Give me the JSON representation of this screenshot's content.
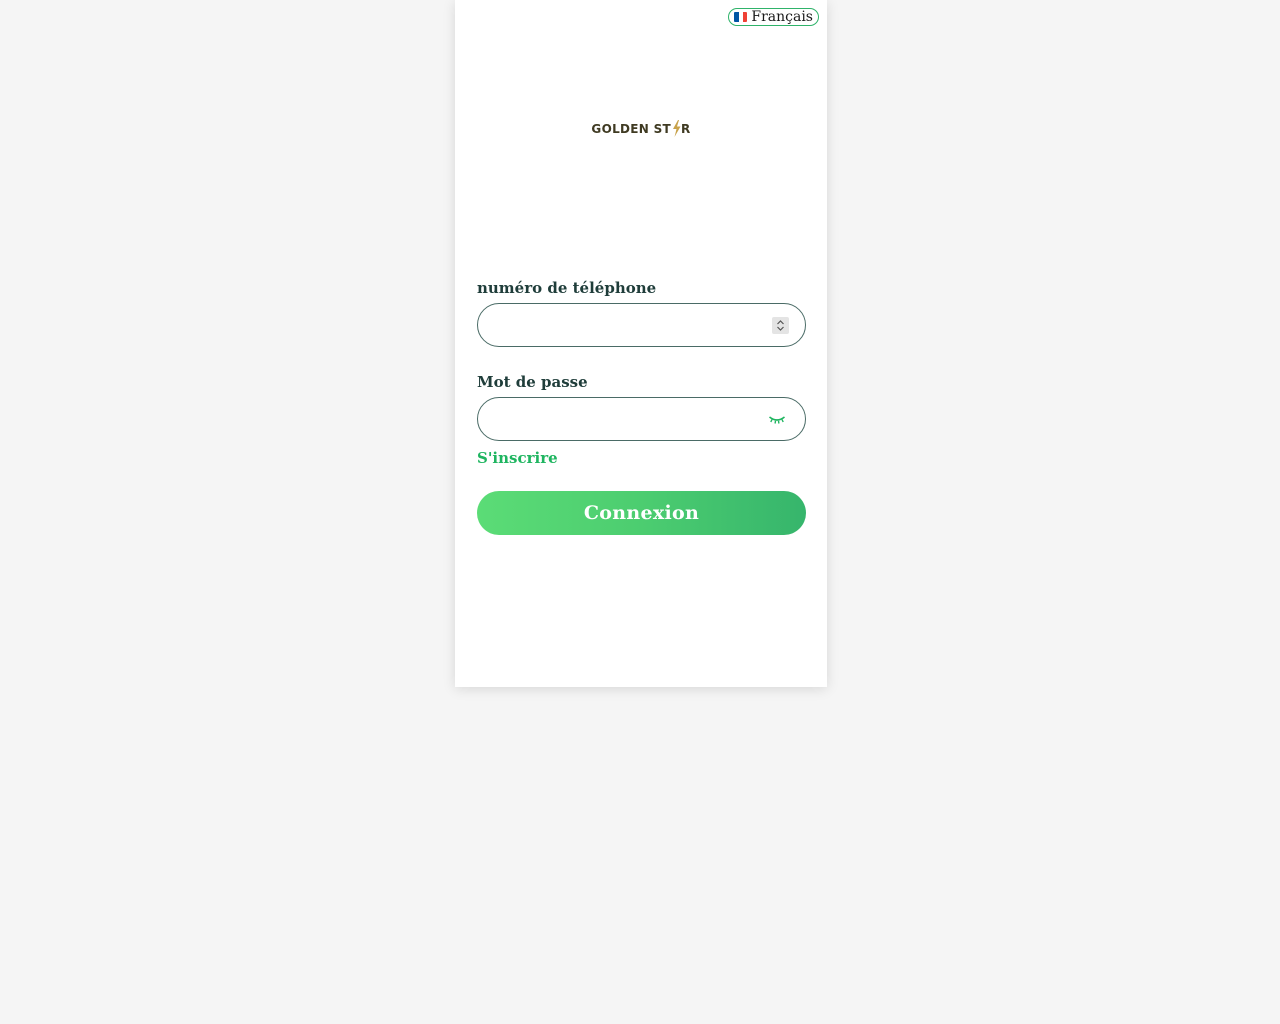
{
  "language": {
    "label": "Français",
    "flag_icon": "flag-fr-icon",
    "flag_colors": [
      "#0055a4",
      "#ffffff",
      "#ef4135"
    ],
    "accent": "#2fb36a"
  },
  "logo": {
    "text_before": "GOLDEN ST",
    "text_after": "R",
    "icon": "lightning-star-icon",
    "text_color": "#3f3a22",
    "icon_color": "#c8a24a"
  },
  "form": {
    "phone_label": "numéro de téléphone",
    "phone_value": "",
    "phone_placeholder": "",
    "password_label": "Mot de passe",
    "password_value": "",
    "password_placeholder": "",
    "password_toggle_icon": "eye-closed-icon"
  },
  "links": {
    "signup": "S'inscrire"
  },
  "actions": {
    "login_label": "Connexion"
  },
  "colors": {
    "background": "#f5f5f5",
    "card": "#ffffff",
    "label": "#1f3d3a",
    "accent_green": "#1fb560",
    "button_gradient_start": "#5bdc76",
    "button_gradient_end": "#36b56c"
  }
}
